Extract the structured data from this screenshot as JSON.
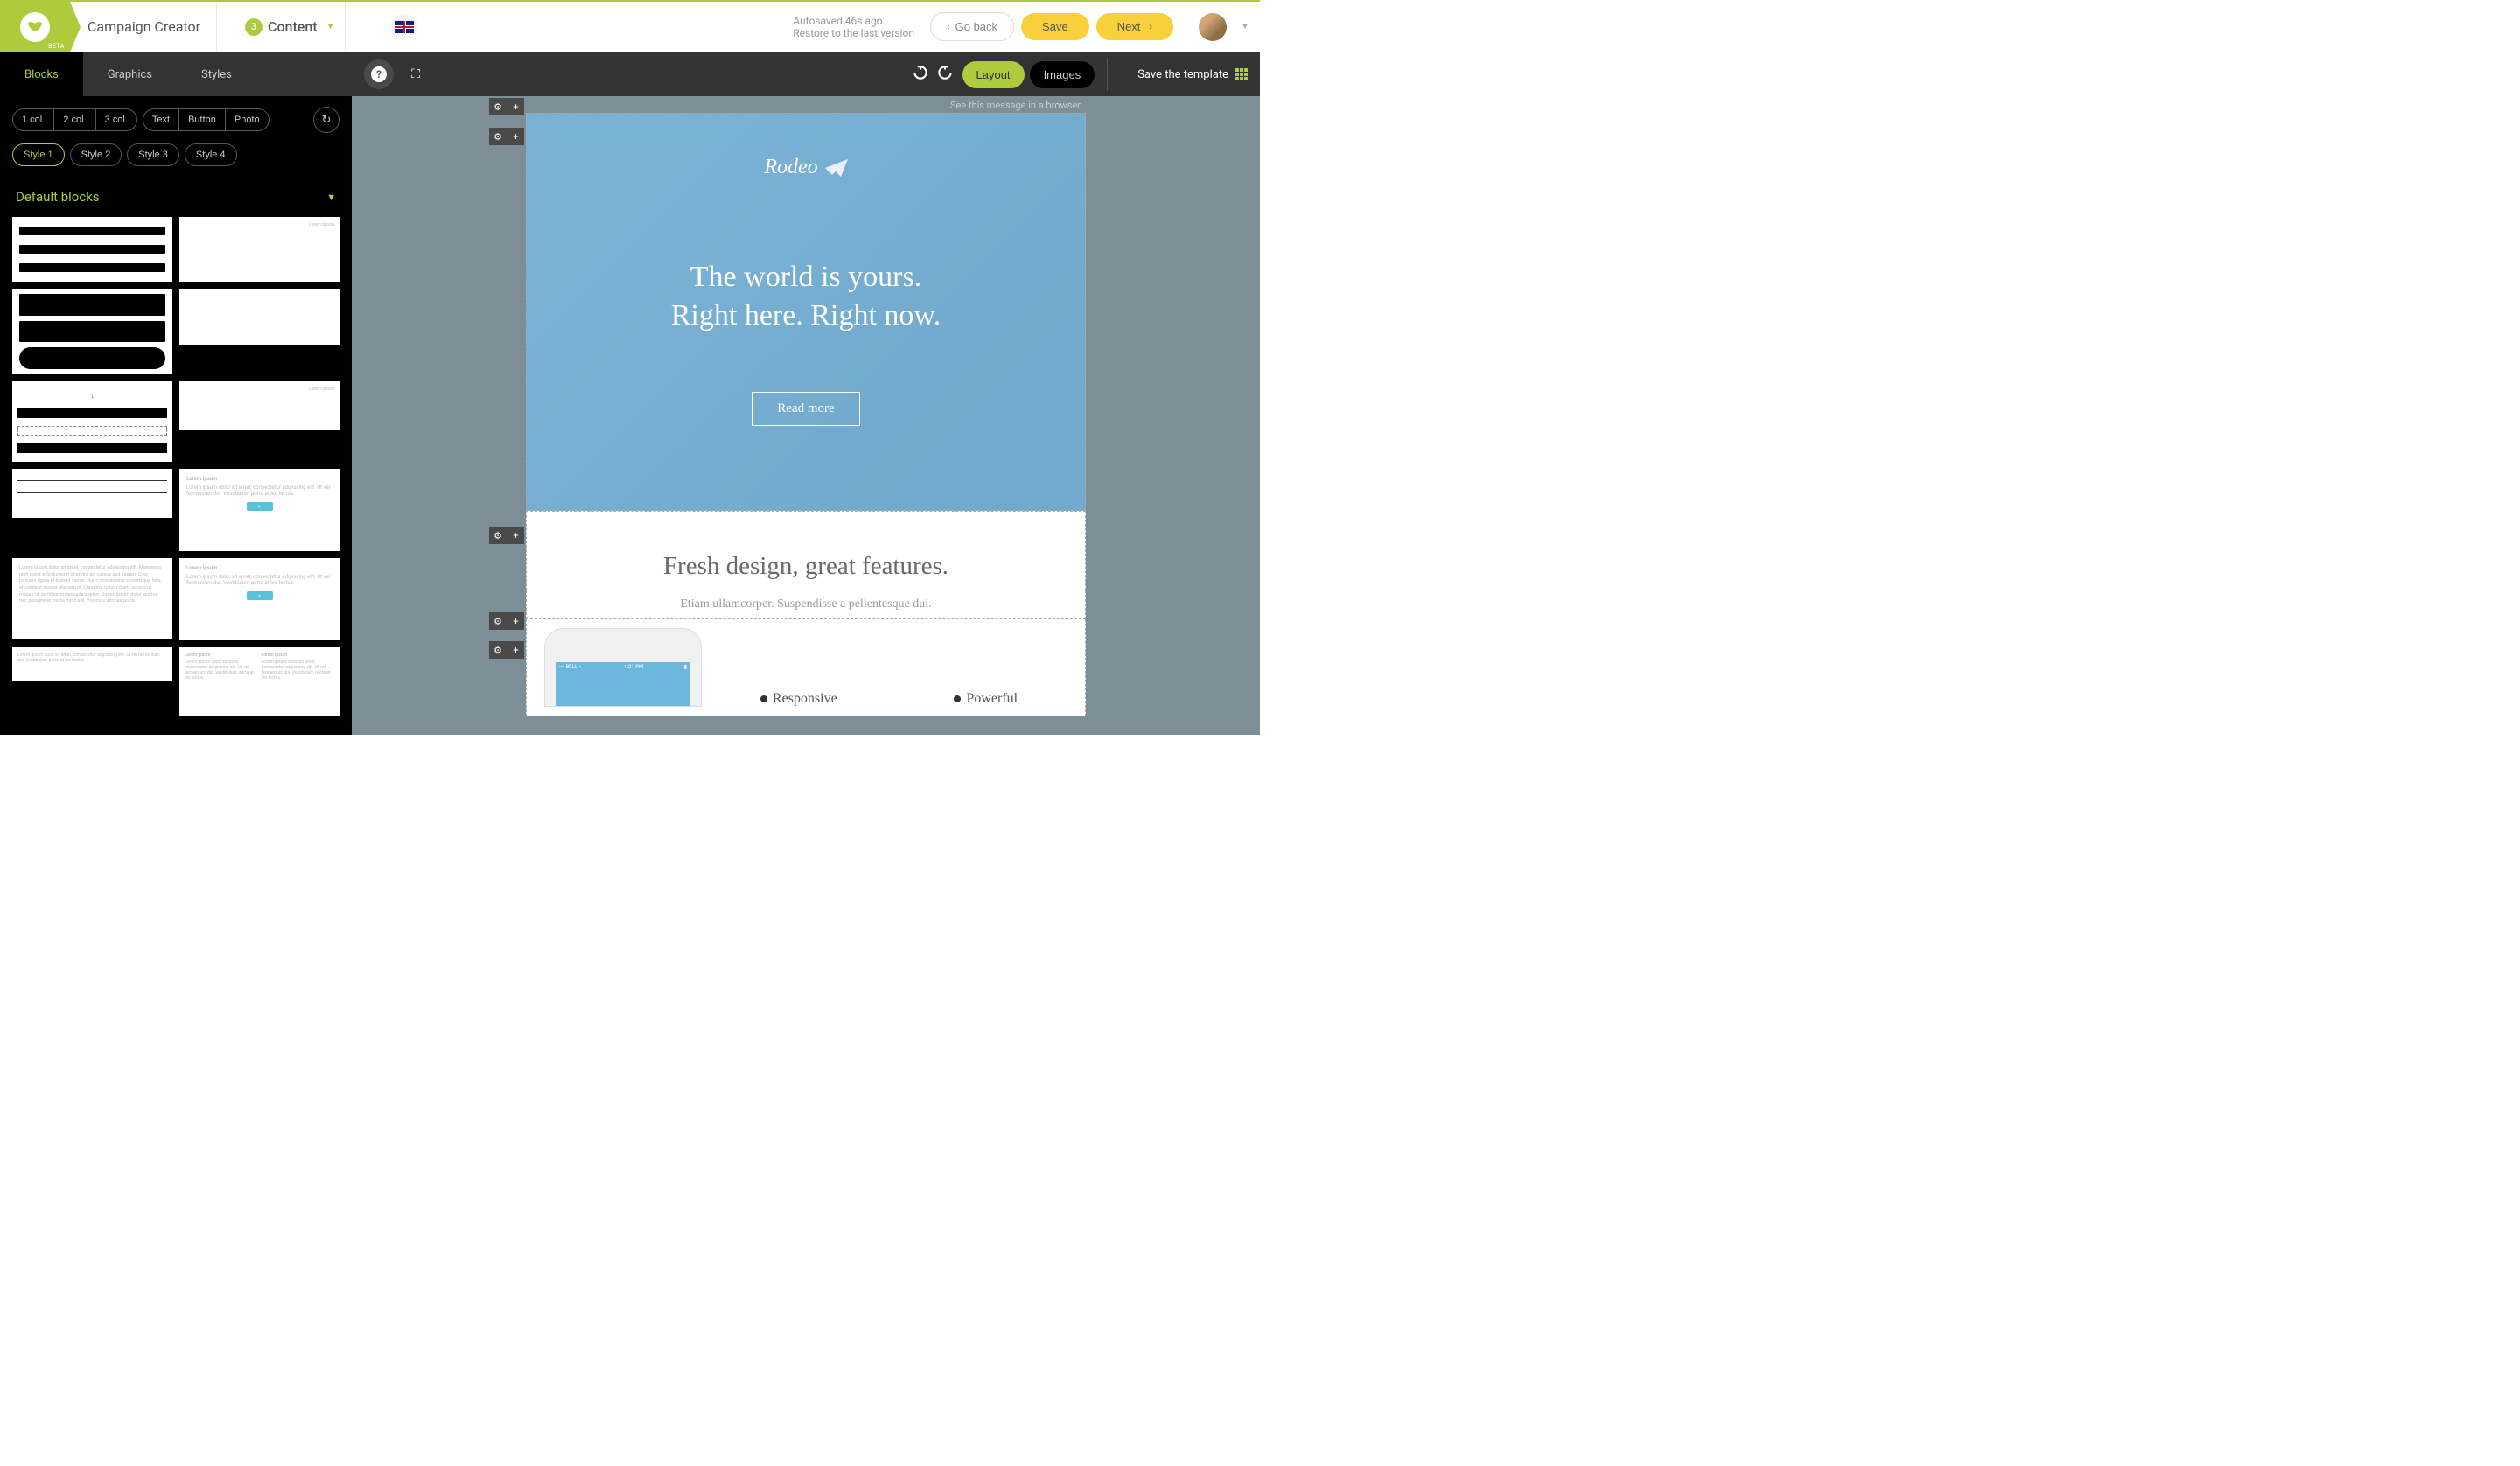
{
  "header": {
    "beta": "BETA",
    "title": "Campaign Creator",
    "step_number": "3",
    "step_label": "Content",
    "autosaved": "Autosaved 46s ago",
    "restore": "Restore to the last version",
    "go_back": "Go back",
    "save": "Save",
    "next": "Next"
  },
  "tabs": {
    "blocks": "Blocks",
    "graphics": "Graphics",
    "styles": "Styles"
  },
  "toolbar": {
    "layout": "Layout",
    "images": "Images",
    "save_template": "Save the template"
  },
  "sidebar": {
    "cols": [
      "1 col.",
      "2 col.",
      "3 col."
    ],
    "types": [
      "Text",
      "Button",
      "Photo"
    ],
    "styles": [
      "Style 1",
      "Style 2",
      "Style 3",
      "Style 4"
    ],
    "section": "Default blocks",
    "lorem_ipsum": "Lorem ipsum",
    "lorem_long": "Lorem ipsum dolor sit amet, consectetur adipiscing elit. Maecenas nibh dolor, efficitur eget pharetra ac, cursus sed sapien. Cras posuere ligula ut blandit varius. Nunc consectetur scelerisque felis, et volutpat massa aliquam in. Curabitur ipsum diam, cursus ut massa ut, porttitor malesuada sapien. Donec ipsum dolor, auctor nec posuere et, molis nunc elit. Vivamus ultrices porta.",
    "lorem_para": "Lorem ipsum dolor sit amet, consectetur adipiscing elit. Ut vel fermentum dui. Vestibulum porta at leo lectus."
  },
  "canvas": {
    "browser_msg": "See this message in a browser",
    "brand": "Rodeo",
    "hero_line1": "The world is yours.",
    "hero_line2": "Right here. Right now.",
    "hero_cta": "Read more",
    "section_title": "Fresh design, great features.",
    "section_sub": "Etiam ullamcorper. Suspendisse a pellentesque dui.",
    "carrier": "BELL",
    "time": "4:21 PM",
    "feature1": "Responsive",
    "feature2": "Powerful"
  }
}
